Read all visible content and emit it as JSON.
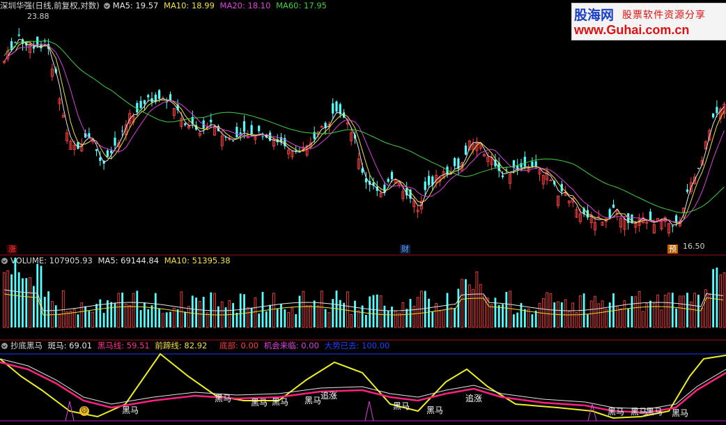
{
  "price_panel": {
    "stock": "深圳华强",
    "period": "(日线,前复权,对数)",
    "ma5": {
      "label": "MA5: 19.57",
      "color": "#e6e6e6"
    },
    "ma10": {
      "label": "MA10: 18.99",
      "color": "#f0e040"
    },
    "ma20": {
      "label": "MA20: 18.10",
      "color": "#e040e0"
    },
    "ma60": {
      "label": "MA60: 17.95",
      "color": "#40d040"
    },
    "high_label": "23.88",
    "low_label": "16.50",
    "markers": [
      "涨",
      "财",
      "预"
    ]
  },
  "volume_panel": {
    "title": "VOLUME: 107905.93",
    "ma5": "MA5: 69144.84",
    "ma10": "MA10: 51395.38"
  },
  "indicator_panel": {
    "title": "抄底黑马",
    "banma": "斑马: 69.01",
    "heima": "黑马线: 59.51",
    "qianti": "前蹄线: 82.92",
    "dibu": "底部: 0.00",
    "jihui": "机会来临: 0.00",
    "dashi": "大势已去: 100.00",
    "signals": [
      "黑马",
      "黑马",
      "黑马",
      "黑马",
      "黑马",
      "追涨",
      "黑马",
      "黑马",
      "追涨",
      "黑马",
      "黑马",
      "黑马",
      "黑马"
    ]
  },
  "watermark": {
    "brand": "股海网",
    "slogan": "股票软件资源分享",
    "url": "www.Guhai.com.cn"
  },
  "colors": {
    "up": "#ff4040",
    "down": "#54ffff",
    "divider": "#a01010"
  }
}
